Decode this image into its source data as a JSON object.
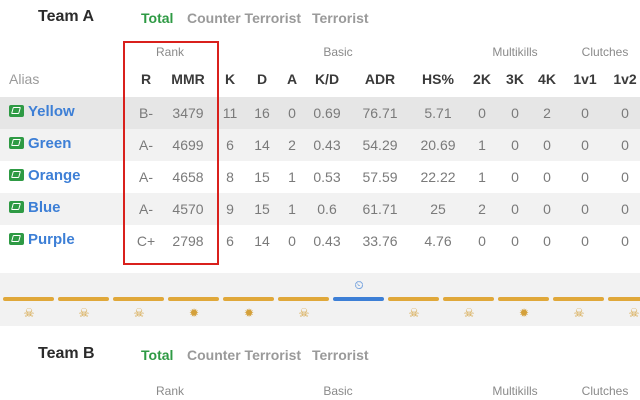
{
  "teamA": {
    "name": "Team A",
    "tabs": [
      "Total",
      "Counter Terrorist",
      "Terrorist"
    ],
    "groups": {
      "rank": "Rank",
      "basic": "Basic",
      "multikills": "Multikills",
      "clutches": "Clutches"
    },
    "alias_label": "Alias",
    "columns": [
      "R",
      "MMR",
      "K",
      "D",
      "A",
      "K/D",
      "ADR",
      "HS%",
      "2K",
      "3K",
      "4K",
      "1v1",
      "1v2"
    ],
    "players": [
      {
        "name": "Yellow",
        "values": [
          "B-",
          "3479",
          "11",
          "16",
          "0",
          "0.69",
          "76.71",
          "5.71",
          "0",
          "0",
          "2",
          "0",
          "0"
        ]
      },
      {
        "name": "Green",
        "values": [
          "A-",
          "4699",
          "6",
          "14",
          "2",
          "0.43",
          "54.29",
          "20.69",
          "1",
          "0",
          "0",
          "0",
          "0"
        ]
      },
      {
        "name": "Orange",
        "values": [
          "A-",
          "4658",
          "8",
          "15",
          "1",
          "0.53",
          "57.59",
          "22.22",
          "1",
          "0",
          "0",
          "0",
          "0"
        ]
      },
      {
        "name": "Blue",
        "values": [
          "A-",
          "4570",
          "9",
          "15",
          "1",
          "0.6",
          "61.71",
          "25",
          "2",
          "0",
          "0",
          "0",
          "0"
        ]
      },
      {
        "name": "Purple",
        "values": [
          "C+",
          "2798",
          "6",
          "14",
          "0",
          "0.43",
          "33.76",
          "4.76",
          "0",
          "0",
          "0",
          "0",
          "0"
        ]
      }
    ]
  },
  "rounds": {
    "segments": [
      "yellow",
      "yellow",
      "yellow",
      "yellow",
      "yellow",
      "yellow",
      "blue",
      "yellow",
      "yellow",
      "yellow",
      "yellow",
      "yellow"
    ],
    "icons": [
      {
        "name": "skull-icon",
        "glyph": "☠"
      },
      {
        "name": "skull-icon",
        "glyph": "☠"
      },
      {
        "name": "skull-icon",
        "glyph": "☠"
      },
      {
        "name": "explosion-icon",
        "glyph": "✹"
      },
      {
        "name": "explosion-icon",
        "glyph": "✹"
      },
      {
        "name": "skull-icon",
        "glyph": "☠"
      },
      {
        "name": "defuse-icon",
        "glyph": "⏲"
      },
      {
        "name": "skull-icon",
        "glyph": "☠"
      },
      {
        "name": "skull-icon",
        "glyph": "☠"
      },
      {
        "name": "explosion-icon",
        "glyph": "✹"
      },
      {
        "name": "skull-icon",
        "glyph": "☠"
      },
      {
        "name": "skull-icon",
        "glyph": "☠"
      }
    ]
  },
  "teamB": {
    "name": "Team B",
    "tabs": [
      "Total",
      "Counter Terrorist",
      "Terrorist"
    ],
    "groups": {
      "rank": "Rank",
      "basic": "Basic",
      "multikills": "Multikills",
      "clutches": "Clutches"
    }
  },
  "colors": {
    "accent_green": "#2e9a44",
    "link_blue": "#3d7fd6",
    "round_yellow": "#e0a83a",
    "highlight_red": "#d9201c"
  }
}
